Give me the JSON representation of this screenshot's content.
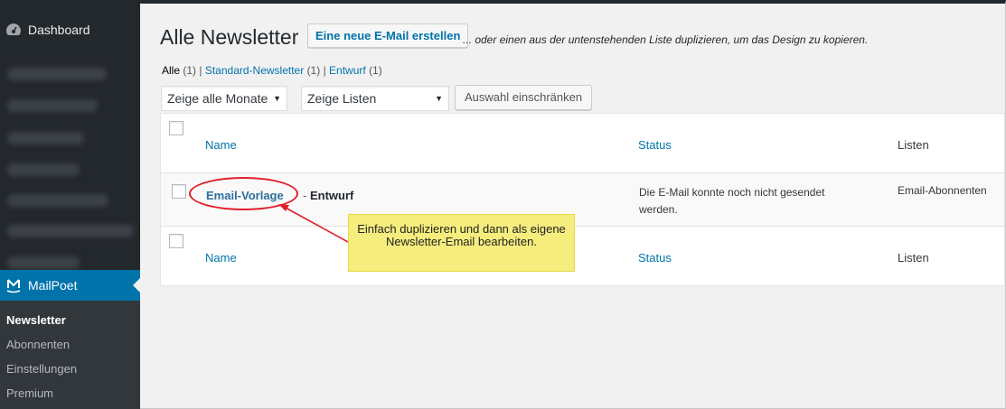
{
  "sidebar": {
    "dashboard_label": "Dashboard",
    "dashboard_icon": "dashboard-gauge-icon",
    "active_menu_label": "MailPoet",
    "active_menu_icon": "mailpoet-logo-icon",
    "active_color": "#0073aa",
    "submenu": [
      {
        "label": "Newsletter",
        "active": true
      },
      {
        "label": "Abonnenten",
        "active": false
      },
      {
        "label": "Einstellungen",
        "active": false
      },
      {
        "label": "Premium",
        "active": false
      }
    ]
  },
  "page": {
    "title": "Alle Newsletter",
    "new_button": "Eine neue E-Mail erstellen",
    "title_note": "... oder einen aus der untenstehenden Liste duplizieren, um das Design zu kopieren.",
    "views": [
      {
        "label": "Alle",
        "count": "(1)",
        "current": true
      },
      {
        "label": "Standard-Newsletter",
        "count": "(1)",
        "current": false
      },
      {
        "label": "Entwurf",
        "count": "(1)",
        "current": false
      }
    ],
    "filters": {
      "months_select": "Zeige alle Monate",
      "lists_select": "Zeige Listen",
      "filter_button": "Auswahl einschränken"
    }
  },
  "table": {
    "columns": {
      "name": "Name",
      "status": "Status",
      "lists": "Listen"
    },
    "rows": [
      {
        "title": "Email-Vorlage",
        "separator": " - ",
        "state": "Entwurf",
        "status": "Die E-Mail konnte noch nicht gesendet werden.",
        "lists": "Email-Abonnenten"
      }
    ]
  },
  "annotation": {
    "callout_text": "Einfach duplizieren und dann als eigene Newsletter-Email bearbeiten.",
    "callout_color": "#f5ee7e",
    "highlight_color": "#e0202a"
  }
}
